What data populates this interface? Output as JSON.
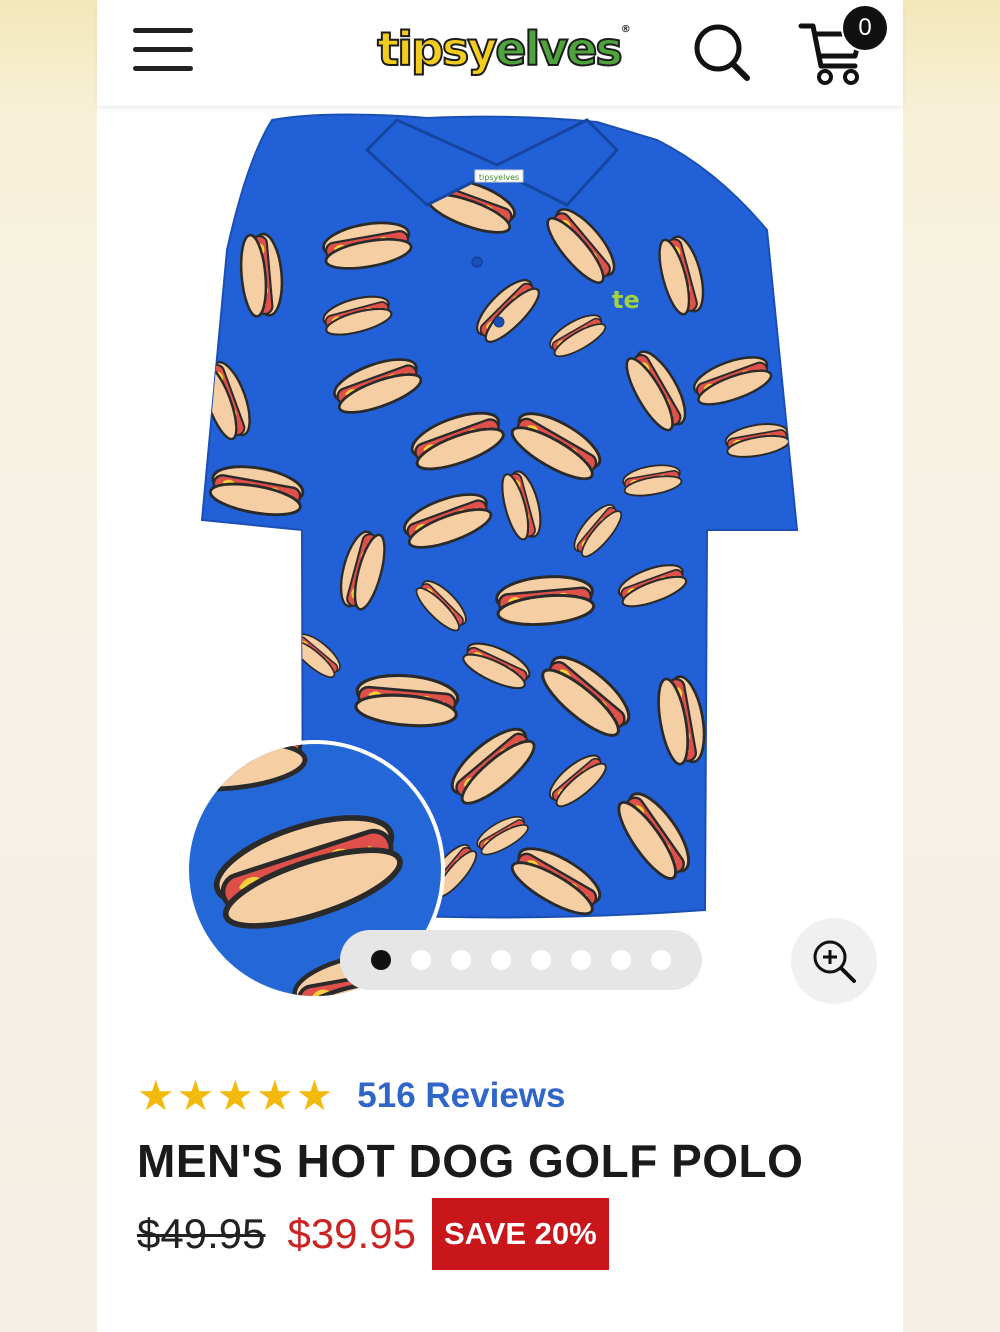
{
  "header": {
    "logo_part1": "tipsy",
    "logo_part2": "elves",
    "logo_mark": "®",
    "cart_count": "0",
    "icons": [
      "hamburger-menu-icon",
      "search-icon",
      "cart-icon"
    ]
  },
  "gallery": {
    "total_images": 8,
    "active_index": 0,
    "pocket_logo": "te",
    "tag_text": "tipsyelves"
  },
  "product": {
    "rating_stars": 5,
    "reviews_label": "516 Reviews",
    "title": "MEN'S HOT DOG GOLF POLO",
    "original_price": "$49.95",
    "sale_price": "$39.95",
    "save_badge": "SAVE 20%"
  },
  "colors": {
    "shirt_blue": "#2160d6",
    "star_gold": "#f3b90b",
    "sale_red": "#cc2222",
    "badge_red": "#c8161b",
    "link_blue": "#2f66c8"
  }
}
